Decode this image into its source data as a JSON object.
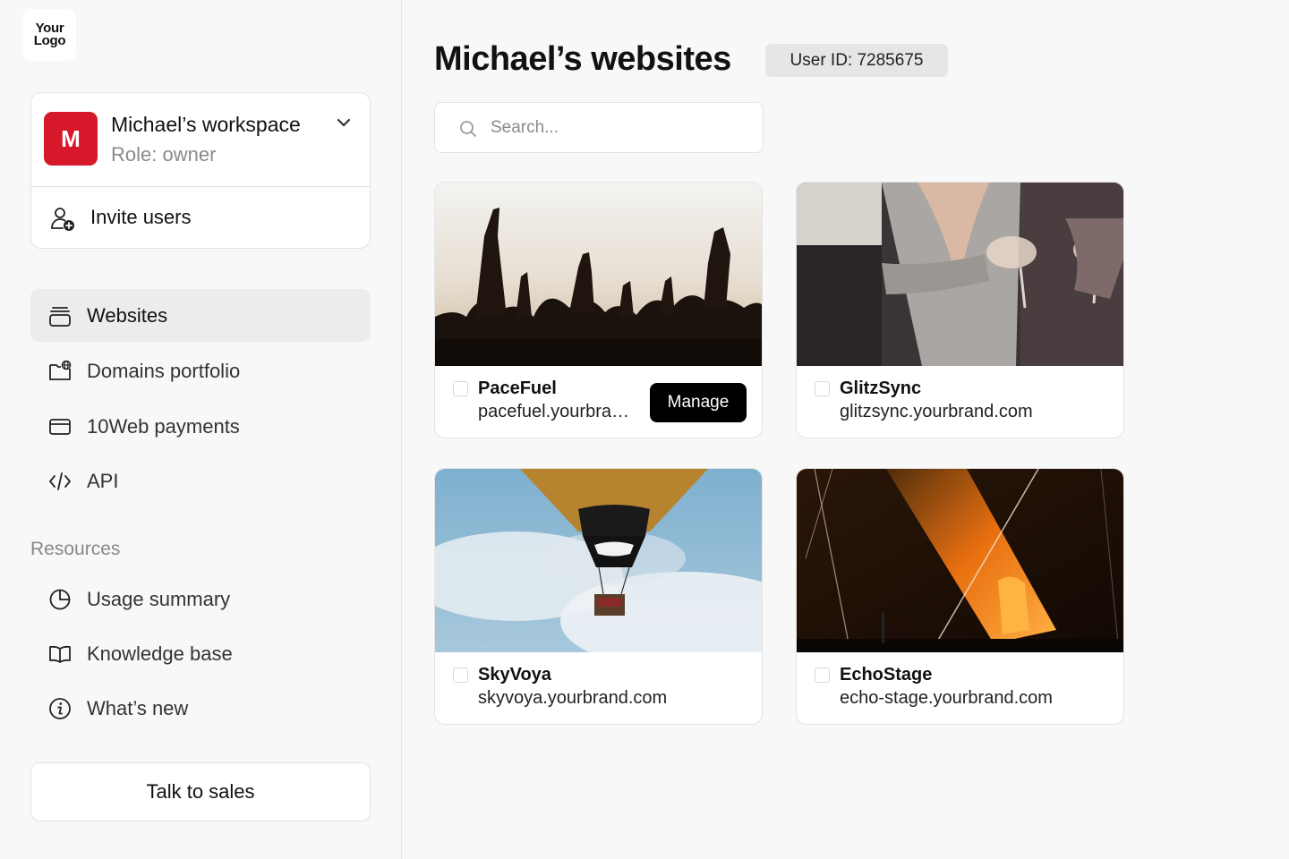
{
  "logo": {
    "line1": "Your",
    "line2": "Logo"
  },
  "workspace": {
    "avatar_letter": "M",
    "name": "Michael’s workspace",
    "role": "Role: owner",
    "invite_label": "Invite users"
  },
  "nav": {
    "websites": "Websites",
    "domains": "Domains portfolio",
    "payments": "10Web payments",
    "api": "API"
  },
  "resources": {
    "heading": "Resources",
    "usage": "Usage summary",
    "knowledge": "Knowledge base",
    "whats_new": "What’s new"
  },
  "sales_label": "Talk to sales",
  "header": {
    "title": "Michael’s websites",
    "user_id": "User ID: 7285675"
  },
  "search": {
    "placeholder": "Search..."
  },
  "sites": [
    {
      "name": "PaceFuel",
      "url": "pacefuel.yourbrand.com",
      "manage_label": "Manage"
    },
    {
      "name": "GlitzSync",
      "url": "glitzsync.yourbrand.com"
    },
    {
      "name": "SkyVoya",
      "url": "skyvoya.yourbrand.com"
    },
    {
      "name": "EchoStage",
      "url": "echo-stage.yourbrand.com"
    }
  ],
  "colors": {
    "brand_red": "#d7172a",
    "active_nav_bg": "#ececec",
    "manage_bg": "#000000"
  }
}
